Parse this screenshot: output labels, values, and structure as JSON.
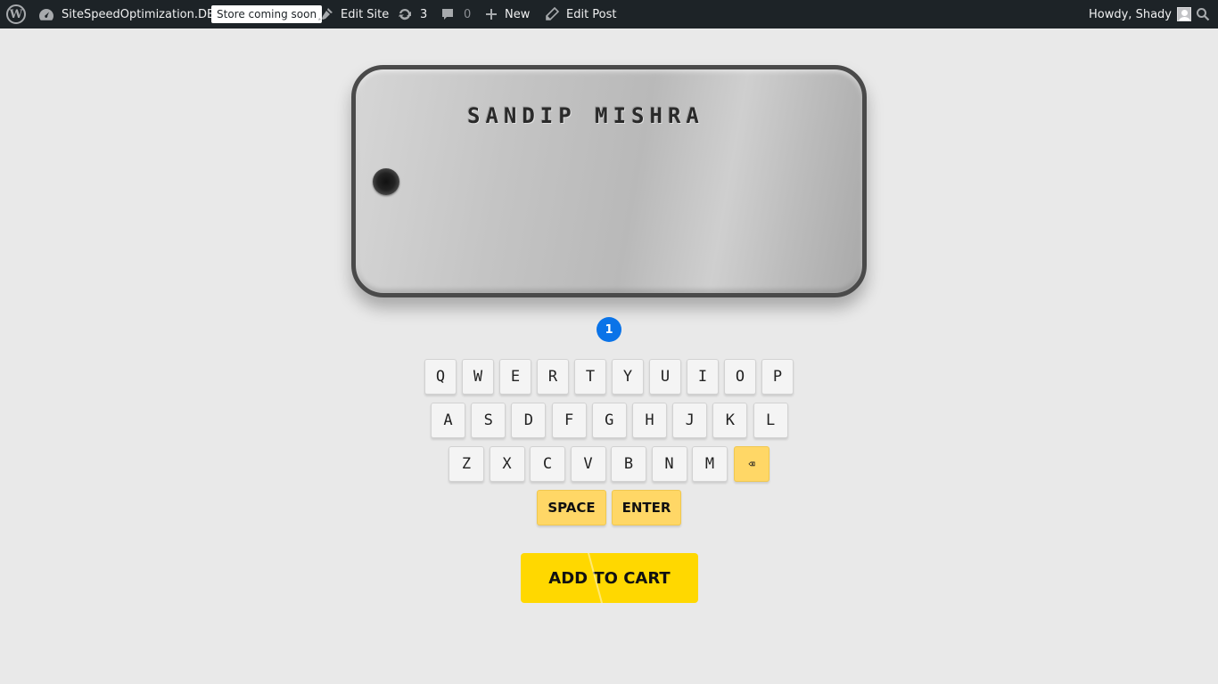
{
  "adminbar": {
    "site_name": "SiteSpeedOptimization.DEV",
    "store_badge": "Store coming soon",
    "edit_site": "Edit Site",
    "updates_count": "3",
    "comments_count": "0",
    "new_label": "New",
    "edit_post": "Edit Post",
    "greeting": "Howdy, Shady"
  },
  "tag": {
    "engraved_text": "SANDIP MISHRA"
  },
  "line_indicator": "1",
  "keyboard": {
    "row1": [
      "Q",
      "W",
      "E",
      "R",
      "T",
      "Y",
      "U",
      "I",
      "O",
      "P"
    ],
    "row2": [
      "A",
      "S",
      "D",
      "F",
      "G",
      "H",
      "J",
      "K",
      "L"
    ],
    "row3": [
      "Z",
      "X",
      "C",
      "V",
      "B",
      "N",
      "M"
    ],
    "backspace": "⌫",
    "space": "SPACE",
    "enter": "ENTER"
  },
  "add_to_cart": "ADD TO CART",
  "colors": {
    "adminbar_bg": "#1d2327",
    "indicator": "#0a73e8",
    "special_key": "#ffd766",
    "cart_button": "#ffd800",
    "page_bg": "#e9e9e9"
  }
}
